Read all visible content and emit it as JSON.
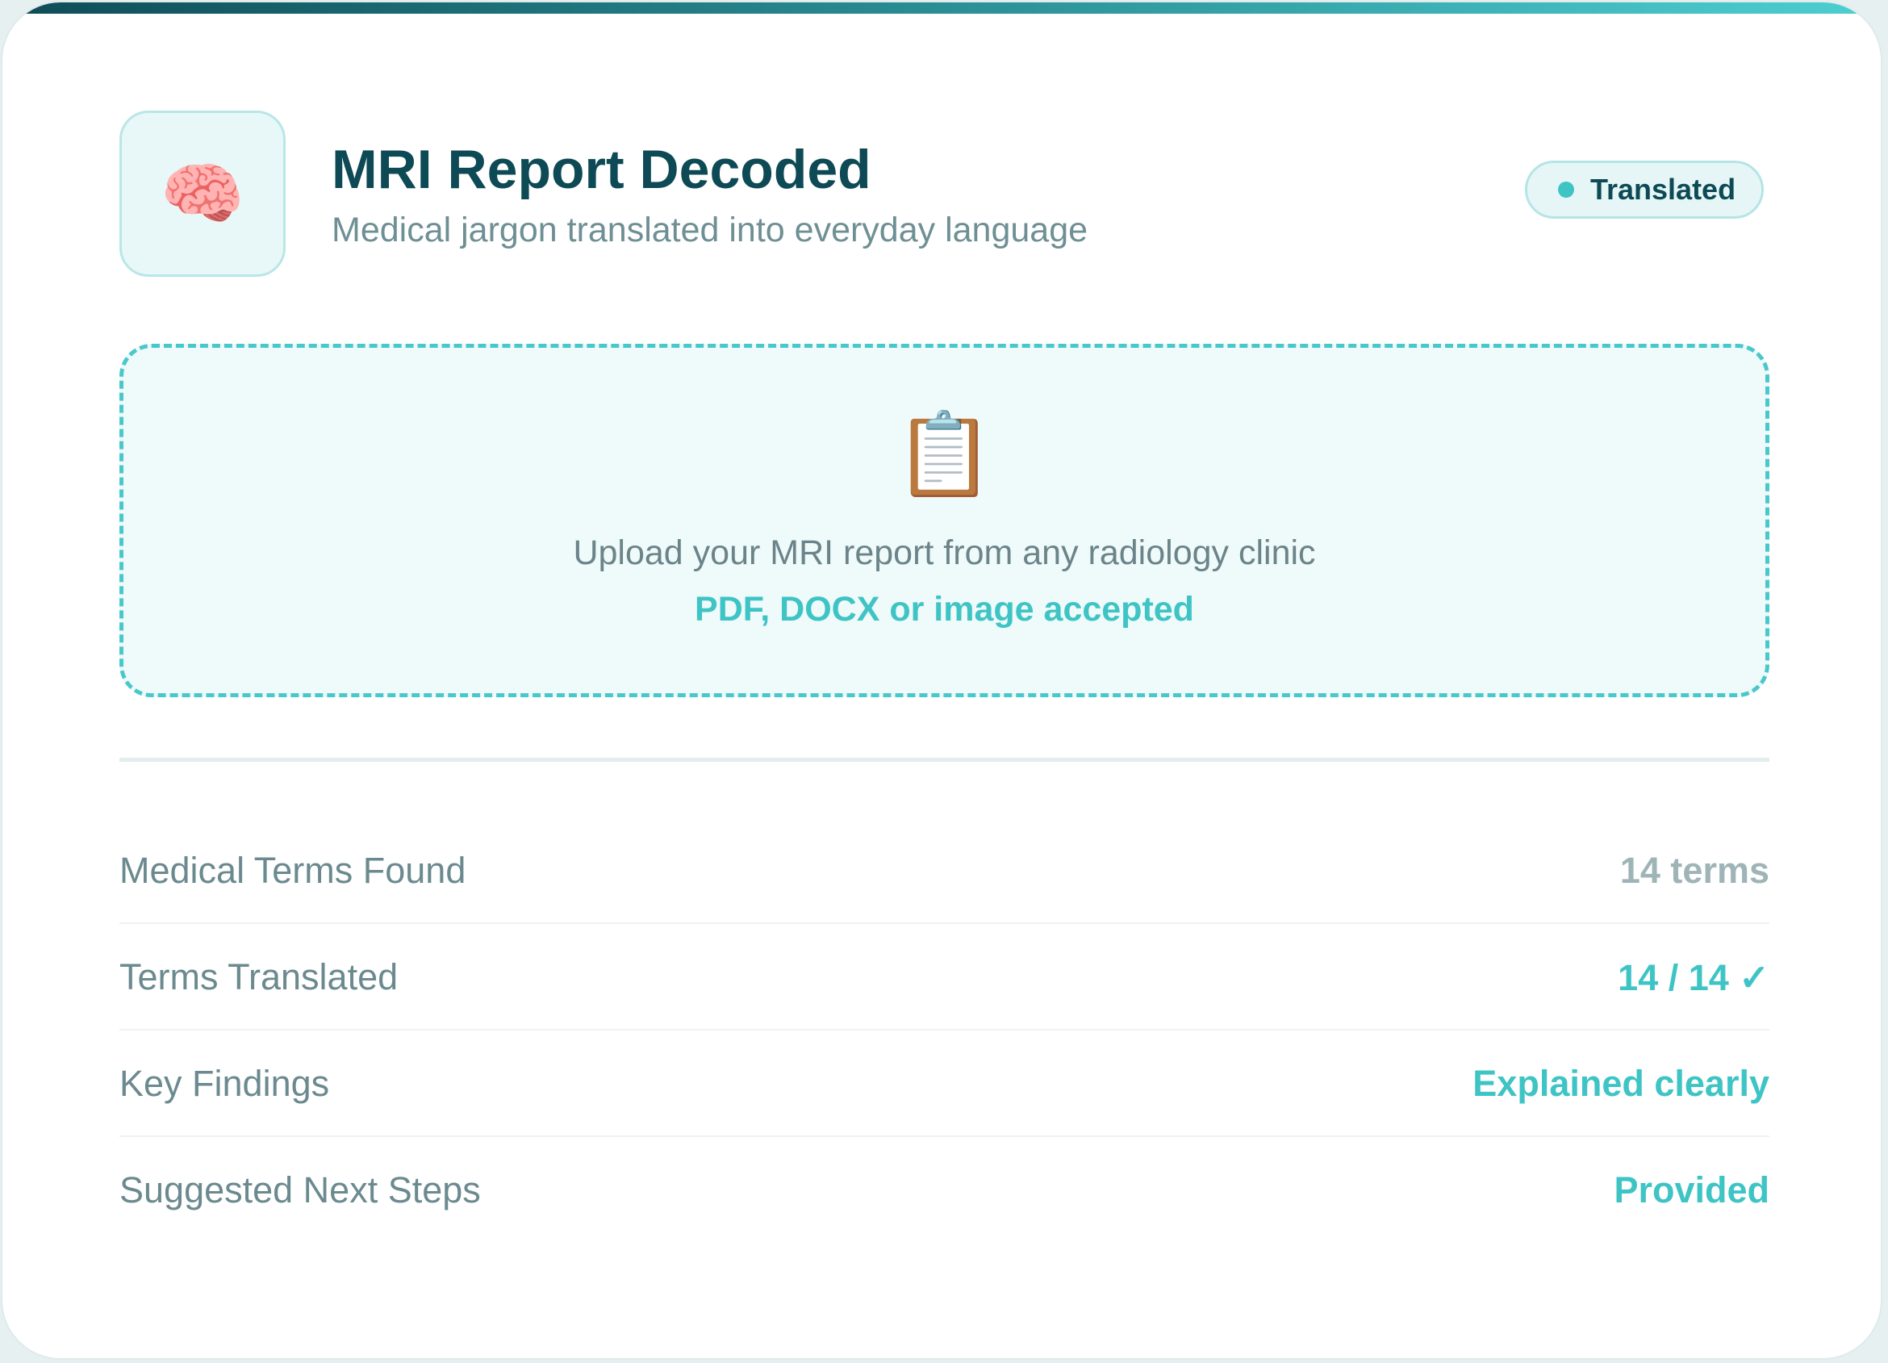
{
  "header": {
    "logo_icon": "brain-icon",
    "logo_glyph": "🧠",
    "title": "MRI Report Decoded",
    "subtitle": "Medical jargon translated into everyday language",
    "status_label": "Translated"
  },
  "upload": {
    "icon": "clipboard-icon",
    "icon_glyph": "📋",
    "prompt": "Upload your MRI report from any radiology clinic",
    "formats": "PDF, DOCX or image accepted"
  },
  "stats": [
    {
      "label": "Medical Terms Found",
      "value": "14 terms"
    },
    {
      "label": "Terms Translated",
      "value": "14 / 14 ✓"
    },
    {
      "label": "Key Findings",
      "value": "Explained clearly"
    },
    {
      "label": "Suggested Next Steps",
      "value": "Provided"
    }
  ],
  "colors": {
    "primary_dark": "#0d4a55",
    "accent": "#3fc4c5",
    "muted_text": "#6b8a8f",
    "muted_value": "#9fb4b7"
  }
}
